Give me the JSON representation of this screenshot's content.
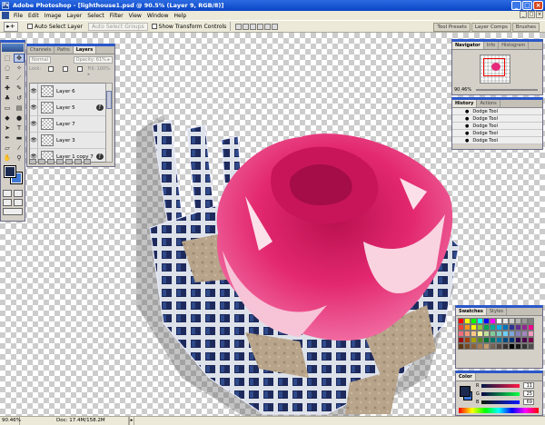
{
  "window": {
    "title": "Adobe Photoshop - [lighthouse1.psd @ 90.5% (Layer 9, RGB/8)]",
    "app_icon": "photoshop-icon",
    "min": "_",
    "max": "□",
    "close": "×"
  },
  "menu": {
    "items": [
      "File",
      "Edit",
      "Image",
      "Layer",
      "Select",
      "Filter",
      "View",
      "Window",
      "Help"
    ],
    "doc_min": "_",
    "doc_max": "□",
    "doc_close": "×"
  },
  "options": {
    "tool_icon": "move-tool-icon",
    "tool_glyph": "▸+",
    "auto_select": "Auto Select Layer",
    "auto_select_groups": "Auto Select Groups",
    "transform_controls": "Show Transform Controls"
  },
  "palette_well": {
    "tabs": [
      "Tool Presets",
      "Layer Comps",
      "Brushes"
    ]
  },
  "layers_panel": {
    "tabs": [
      "Channels",
      "Paths",
      "Layers"
    ],
    "blend_mode": "Normal",
    "opacity": "Opacity: 61% ▸",
    "lock": "Lock:",
    "fill": "Fill: 100% ▸",
    "layers": [
      {
        "name": "Layer 6",
        "visible": "👁",
        "fx": ""
      },
      {
        "name": "Layer 5",
        "visible": "👁",
        "fx": "ƒ"
      },
      {
        "name": "Layer 7",
        "visible": "👁",
        "fx": ""
      },
      {
        "name": "Layer 3",
        "visible": "👁",
        "fx": ""
      },
      {
        "name": "Layer 1 copy 7",
        "visible": "👁",
        "fx": "ƒ"
      }
    ]
  },
  "navigator": {
    "tabs": [
      "Navigator",
      "Info",
      "Histogram"
    ],
    "zoom": "90.46%"
  },
  "history": {
    "tabs": [
      "History",
      "Actions"
    ],
    "items": [
      "Dodge Tool",
      "Dodge Tool",
      "Dodge Tool",
      "Dodge Tool",
      "Dodge Tool"
    ]
  },
  "swatches": {
    "tabs": [
      "Swatches",
      "Styles"
    ],
    "colors": [
      "#ff0000",
      "#ffff00",
      "#00ff00",
      "#00ffff",
      "#0000ff",
      "#ff00ff",
      "#ffffff",
      "#e6e6e6",
      "#cccccc",
      "#b3b3b3",
      "#999999",
      "#808080",
      "#ef4136",
      "#f7941d",
      "#fff200",
      "#8dc63f",
      "#00a651",
      "#00a99d",
      "#00aeef",
      "#0072bc",
      "#2e3192",
      "#662d91",
      "#92278f",
      "#ec008c",
      "#f26d7d",
      "#f69679",
      "#fdc689",
      "#fff799",
      "#c4df9b",
      "#82ca9c",
      "#7accc8",
      "#6dcff6",
      "#7da7d9",
      "#8781bd",
      "#a186be",
      "#f49ac1",
      "#9e0b0f",
      "#a0410d",
      "#aba000",
      "#598527",
      "#007236",
      "#00746b",
      "#0076a3",
      "#004a80",
      "#003471",
      "#32004b",
      "#4b0049",
      "#7b0046",
      "#603913",
      "#754c24",
      "#8c6239",
      "#a67c52",
      "#c69c6d",
      "#736357",
      "#534741",
      "#362f2d",
      "#000000",
      "#1a1a1a",
      "#333333",
      "#4d4d4d"
    ]
  },
  "color_panel": {
    "tabs": [
      "Color"
    ],
    "channels": [
      {
        "label": "R",
        "value": "11"
      },
      {
        "label": "G",
        "value": "25"
      },
      {
        "label": "B",
        "value": "69"
      }
    ]
  },
  "colors": {
    "foreground": "#1b2a4e",
    "background": "#3f78d4",
    "accent": "#2b58c9"
  },
  "status": {
    "zoom": "90.46%",
    "doc": "Doc: 17.4M/158.2M",
    "arrow": "▸"
  }
}
